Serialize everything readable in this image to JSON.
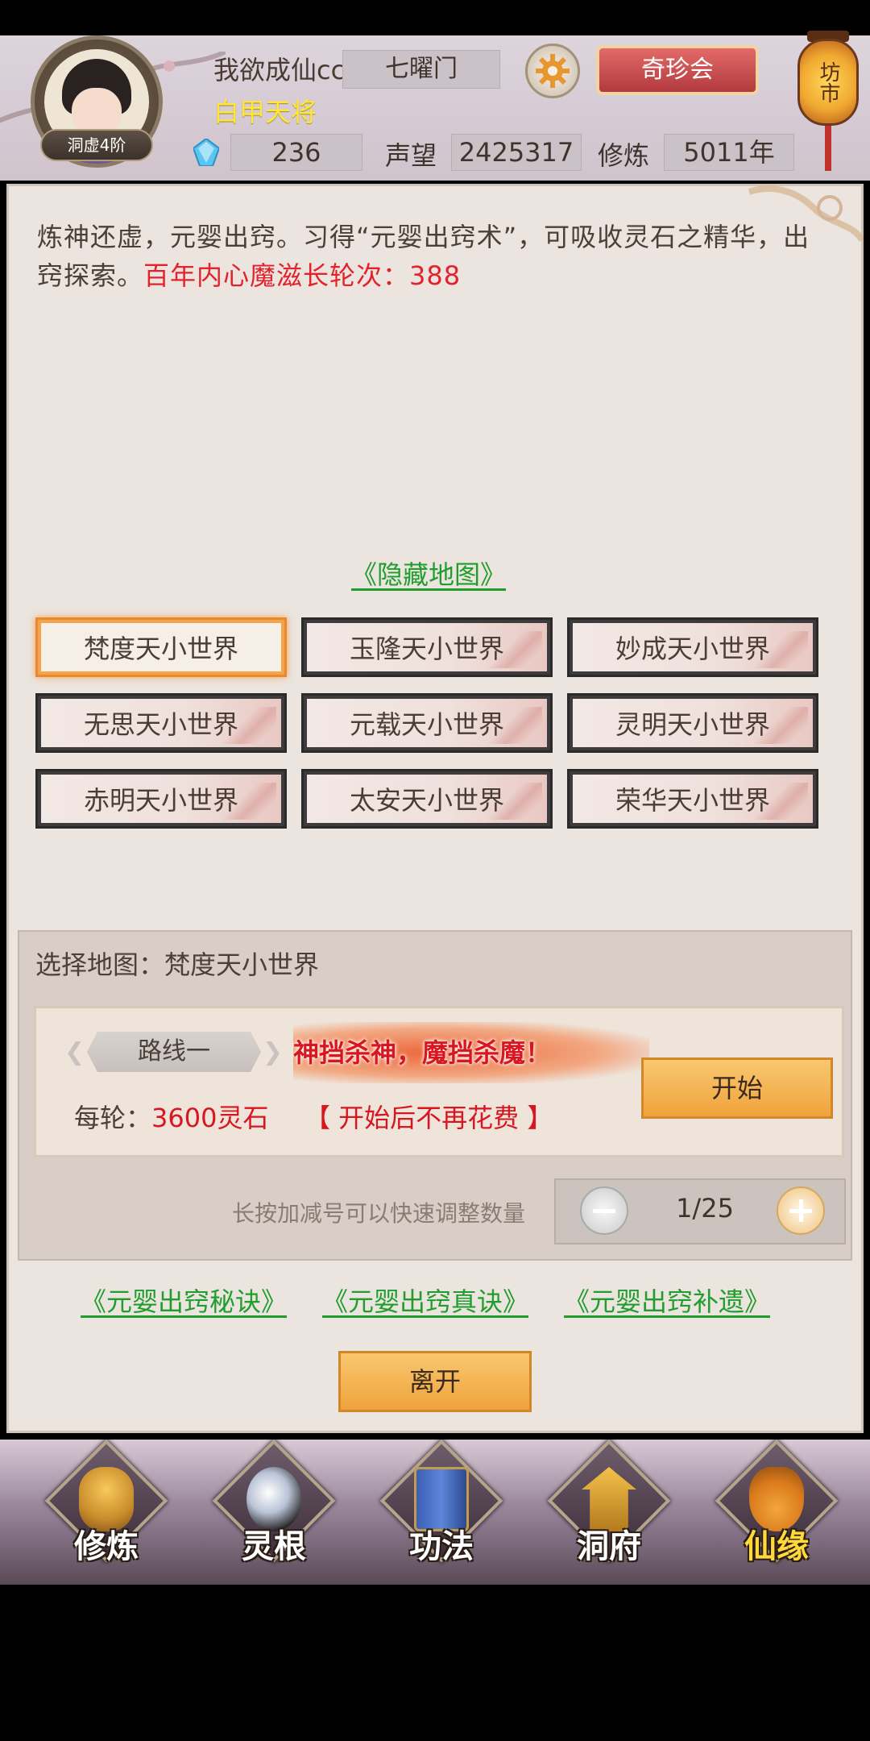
{
  "header": {
    "player_name": "我欲成仙cc",
    "sect": "七曜门",
    "title_badge": "白甲天将",
    "rank": "洞虚4阶",
    "spirit_stones": "236",
    "reputation_label": "声望",
    "reputation": "2425317",
    "cultivation_label": "修炼",
    "cultivation": "5011年",
    "treasure_button": "奇珍会",
    "market_lantern": "坊市"
  },
  "main": {
    "description": "炼神还虚，元婴出窍。习得“元婴出窍术”，可吸收灵石之精华，出窍探索。",
    "warning": "百年内心魔滋长轮次：388",
    "hidden_map_link": "《隐藏地图》",
    "worlds": [
      {
        "label": "梵度天小世界",
        "selected": true
      },
      {
        "label": "玉隆天小世界",
        "selected": false
      },
      {
        "label": "妙成天小世界",
        "selected": false
      },
      {
        "label": "无思天小世界",
        "selected": false
      },
      {
        "label": "元载天小世界",
        "selected": false
      },
      {
        "label": "灵明天小世界",
        "selected": false
      },
      {
        "label": "赤明天小世界",
        "selected": false
      },
      {
        "label": "太安天小世界",
        "selected": false
      },
      {
        "label": "荣华天小世界",
        "selected": false
      }
    ],
    "select_label": "选择地图：梵度天小世界",
    "route_label": "路线一",
    "slogan": "神挡杀神，魔挡杀魔！",
    "cost_prefix": "每轮：",
    "cost_value": "3600灵石",
    "cost_note": "【 开始后不再花费 】",
    "start_button": "开始",
    "hint": "长按加减号可以快速调整数量",
    "counter_value": "1/25",
    "secret_links": [
      "《元婴出窍秘诀》",
      "《元婴出窍真诀》",
      "《元婴出窍补遗》"
    ],
    "leave_button": "离开"
  },
  "nav": {
    "items": [
      {
        "label": "修炼",
        "icon": "cultivate-icon"
      },
      {
        "label": "灵根",
        "icon": "spirit-root-icon"
      },
      {
        "label": "功法",
        "icon": "technique-book-icon"
      },
      {
        "label": "洞府",
        "icon": "cave-residence-icon"
      },
      {
        "label": "仙缘",
        "icon": "gourd-icon"
      }
    ]
  },
  "colors": {
    "warning_red": "#e3222b",
    "link_green": "#1f9e2d",
    "title_yellow": "#ffe63a",
    "button_orange": "#f0a33c"
  }
}
